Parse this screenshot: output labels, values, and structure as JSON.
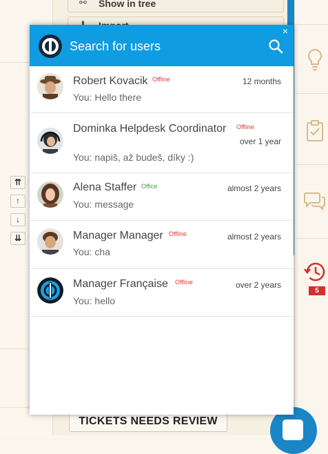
{
  "background": {
    "buttons": [
      {
        "label": "Show in tree",
        "icon": "tree-icon"
      },
      {
        "label": "Import",
        "icon": "import-icon"
      }
    ],
    "sort_buttons": [
      "⇈",
      "↑",
      "↓",
      "⇊"
    ],
    "tickets_button": "TICKETS NEEDS REVIEW",
    "history_badge": "5"
  },
  "popup": {
    "search_placeholder": "Search for users",
    "close_label": "×",
    "users": [
      {
        "name": "Robert Kovacik",
        "status": "Offline",
        "time": "12 months",
        "message": "You: Hello there",
        "avatar": "hat-person"
      },
      {
        "name": "Dominka Helpdesk Coordinator",
        "status": "Offline",
        "time": "over 1 year",
        "message": "You: napiš, až budeš, díky :)",
        "avatar": "headset-person"
      },
      {
        "name": "Alena Staffer",
        "status": "Office",
        "time": "almost 2 years",
        "message": "You: message",
        "avatar": "woman"
      },
      {
        "name": "Manager Manager",
        "status": "Offline",
        "time": "almost 2 years",
        "message": "You: cha",
        "avatar": "man"
      },
      {
        "name": "Manager Française",
        "status": "Offline",
        "time": "over 2 years",
        "message": "You: hello",
        "avatar": "logo"
      }
    ]
  },
  "colors": {
    "header": "#0f9ce0",
    "offline": "#e53935",
    "online": "#43a047",
    "accent_blue": "#1b86c7"
  }
}
